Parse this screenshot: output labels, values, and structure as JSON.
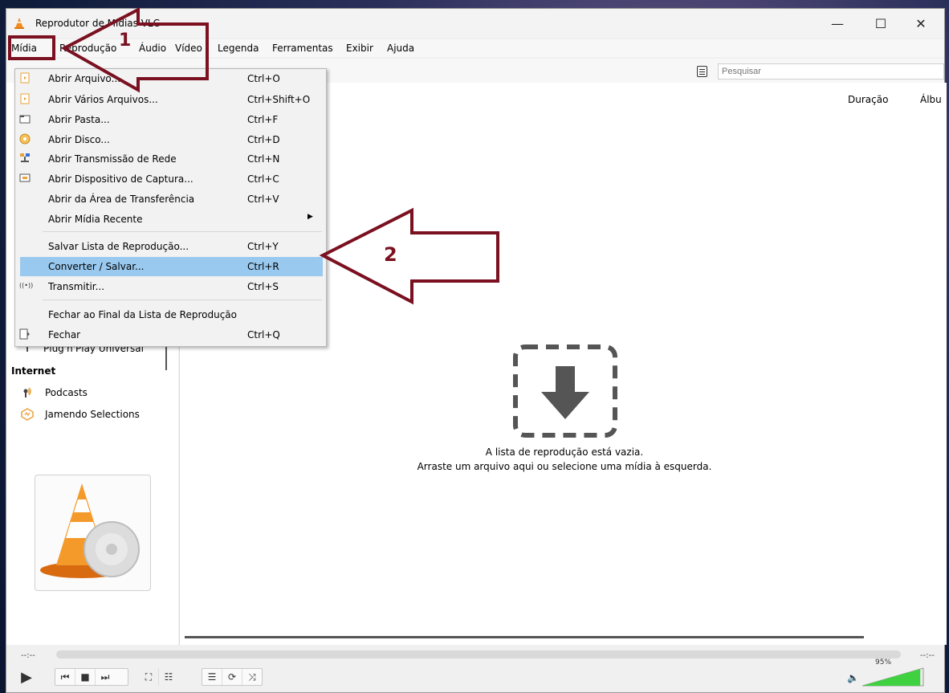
{
  "window": {
    "title": "Reprodutor de Mídias VLC",
    "minimize": "—",
    "maximize": "☐",
    "close": "✕"
  },
  "menubar": [
    "Mídia",
    "Reprodução",
    "Áudio",
    "Vídeo",
    "Legenda",
    "Ferramentas",
    "Exibir",
    "Ajuda"
  ],
  "search": {
    "placeholder": "Pesquisar"
  },
  "columns": {
    "duration": "Duração",
    "album": "Álbu"
  },
  "sidebar": {
    "partial_item": "Plug'n'Play Universal",
    "section_internet": "Internet",
    "items": [
      "Podcasts",
      "Jamendo Selections"
    ]
  },
  "media_menu": [
    {
      "label": "Abrir Arquivo...",
      "shortcut": "Ctrl+O",
      "icon": "file-icon"
    },
    {
      "label": "Abrir Vários Arquivos...",
      "shortcut": "Ctrl+Shift+O",
      "icon": "file-icon"
    },
    {
      "label": "Abrir Pasta...",
      "shortcut": "Ctrl+F",
      "icon": "folder-icon"
    },
    {
      "label": "Abrir Disco...",
      "shortcut": "Ctrl+D",
      "icon": "disc-icon"
    },
    {
      "label": "Abrir Transmissão de Rede",
      "shortcut": "Ctrl+N",
      "icon": "network-icon"
    },
    {
      "label": "Abrir Dispositivo de Captura...",
      "shortcut": "Ctrl+C",
      "icon": "capture-icon"
    },
    {
      "label": "Abrir da Área de Transferência",
      "shortcut": "Ctrl+V",
      "icon": ""
    },
    {
      "label": "Abrir Mídia Recente",
      "shortcut": "",
      "icon": "submenu-arrow-icon"
    },
    {
      "label": "Salvar Lista de Reprodução...",
      "shortcut": "Ctrl+Y",
      "icon": ""
    },
    {
      "label": "Converter / Salvar...",
      "shortcut": "Ctrl+R",
      "icon": "",
      "highlighted": true
    },
    {
      "label": "Transmitir...",
      "shortcut": "Ctrl+S",
      "icon": "stream-icon"
    },
    {
      "label": "Fechar ao Final da Lista de Reprodução",
      "shortcut": "",
      "icon": ""
    },
    {
      "label": "Fechar",
      "shortcut": "Ctrl+Q",
      "icon": "exit-icon"
    }
  ],
  "empty_playlist": {
    "line1": "A lista de reprodução está vazia.",
    "line2": "Arraste um arquivo aqui ou selecione uma mídia à esquerda."
  },
  "player": {
    "time_elapsed": "--:--",
    "time_total": "--:--",
    "volume_label": "95%",
    "volume_level": 0.95
  },
  "annotations": {
    "arrow1": "1",
    "arrow2": "2",
    "color": "#7a1020"
  },
  "colors": {
    "highlight": "#99c9ef",
    "volume_fill": "#3fd13f"
  }
}
